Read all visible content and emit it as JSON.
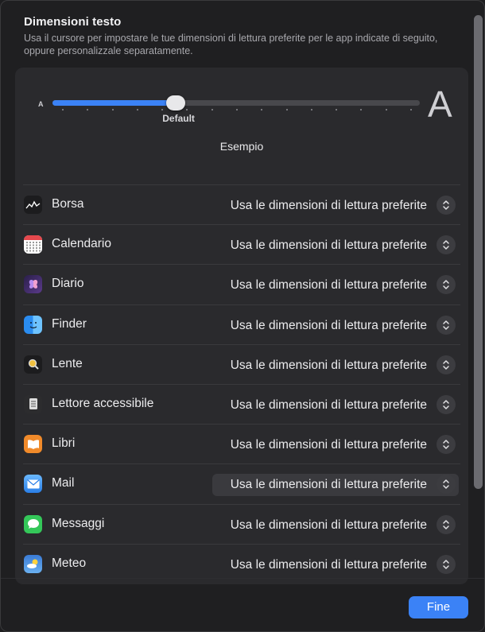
{
  "header": {
    "title": "Dimensioni testo",
    "description": "Usa il cursore per impostare le tue dimensioni di lettura preferite per le app indicate di seguito, oppure personalizzale separatamente."
  },
  "slider": {
    "small_label": "A",
    "large_label": "A",
    "default_label": "Default",
    "value_fraction": 0.3,
    "tick_count": 15
  },
  "preview_label": "Esempio",
  "apps": [
    {
      "name": "Borsa",
      "icon": "stocks-icon",
      "setting": "Usa le dimensioni di lettura preferite"
    },
    {
      "name": "Calendario",
      "icon": "calendar-icon",
      "setting": "Usa le dimensioni di lettura preferite"
    },
    {
      "name": "Diario",
      "icon": "journal-icon",
      "setting": "Usa le dimensioni di lettura preferite"
    },
    {
      "name": "Finder",
      "icon": "finder-icon",
      "setting": "Usa le dimensioni di lettura preferite"
    },
    {
      "name": "Lente",
      "icon": "magnifier-icon",
      "setting": "Usa le dimensioni di lettura preferite"
    },
    {
      "name": "Lettore accessibile",
      "icon": "accessibility-reader-icon",
      "setting": "Usa le dimensioni di lettura preferite"
    },
    {
      "name": "Libri",
      "icon": "books-icon",
      "setting": "Usa le dimensioni di lettura preferite"
    },
    {
      "name": "Mail",
      "icon": "mail-icon",
      "setting": "Usa le dimensioni di lettura preferite",
      "highlighted": true
    },
    {
      "name": "Messaggi",
      "icon": "messages-icon",
      "setting": "Usa le dimensioni di lettura preferite"
    },
    {
      "name": "Meteo",
      "icon": "weather-icon",
      "setting": "Usa le dimensioni di lettura preferite"
    }
  ],
  "done_button": "Fine",
  "colors": {
    "accent": "#3b82f6",
    "background": "#1f1f21",
    "panel": "#2a2a2d"
  }
}
